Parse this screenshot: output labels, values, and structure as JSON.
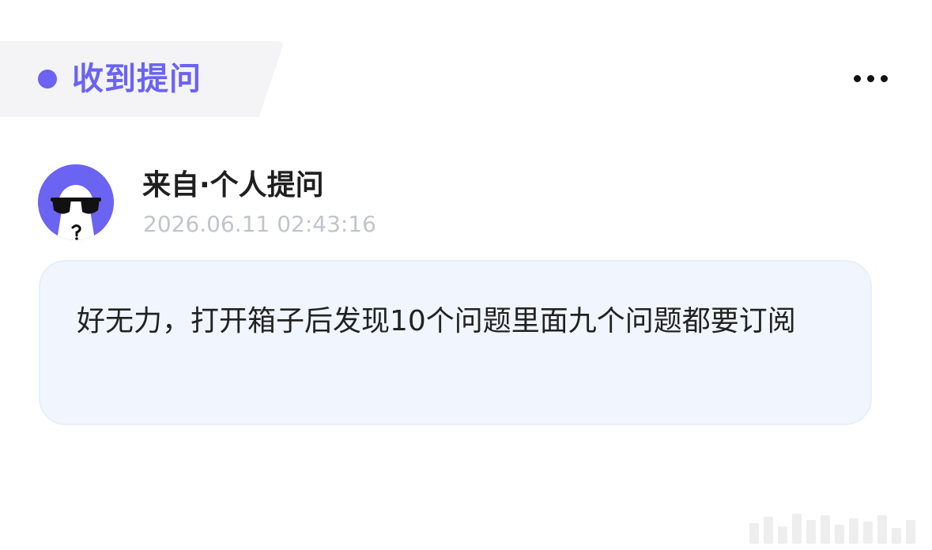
{
  "header": {
    "title": "收到提问",
    "accent_color": "#6b63f2",
    "more_icon": "more-horizontal-icon"
  },
  "asker": {
    "name": "来自·个人提问",
    "timestamp": "2026.06.11 02:43:16",
    "avatar_icon": "anonymous-sunglasses-avatar"
  },
  "question": {
    "text": "好无力，打开箱子后发现10个问题里面九个问题都要订阅"
  }
}
